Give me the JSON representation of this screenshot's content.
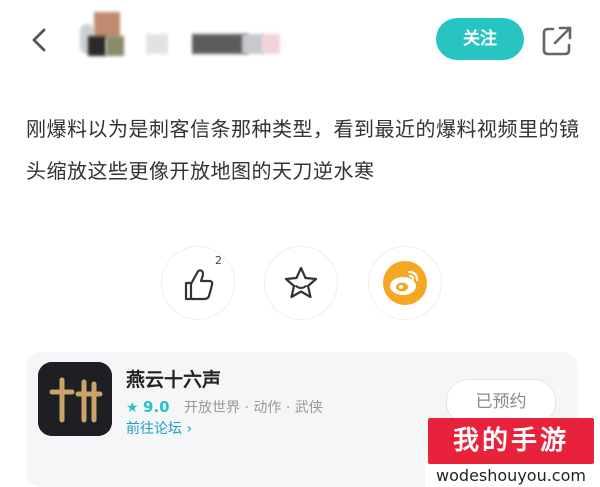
{
  "header": {
    "follow_label": "关注"
  },
  "post": {
    "text": "刚爆料以为是刺客信条那种类型，看到最近的爆料视频里的镜头缩放这些更像开放地图的天刀逆水寒"
  },
  "actions": {
    "like_count": "2"
  },
  "game_card": {
    "title": "燕云十六声",
    "rating": "9.0",
    "tags": "开放世界 · 动作 · 武侠",
    "forum_link": "前往论坛",
    "reserve_label": "已预约"
  },
  "watermark": {
    "brand": "我的手游",
    "url": "wodeshouyou.com"
  },
  "colors": {
    "accent": "#28c4c2",
    "weibo_orange": "#f5a623",
    "watermark_red": "#e8223b"
  }
}
